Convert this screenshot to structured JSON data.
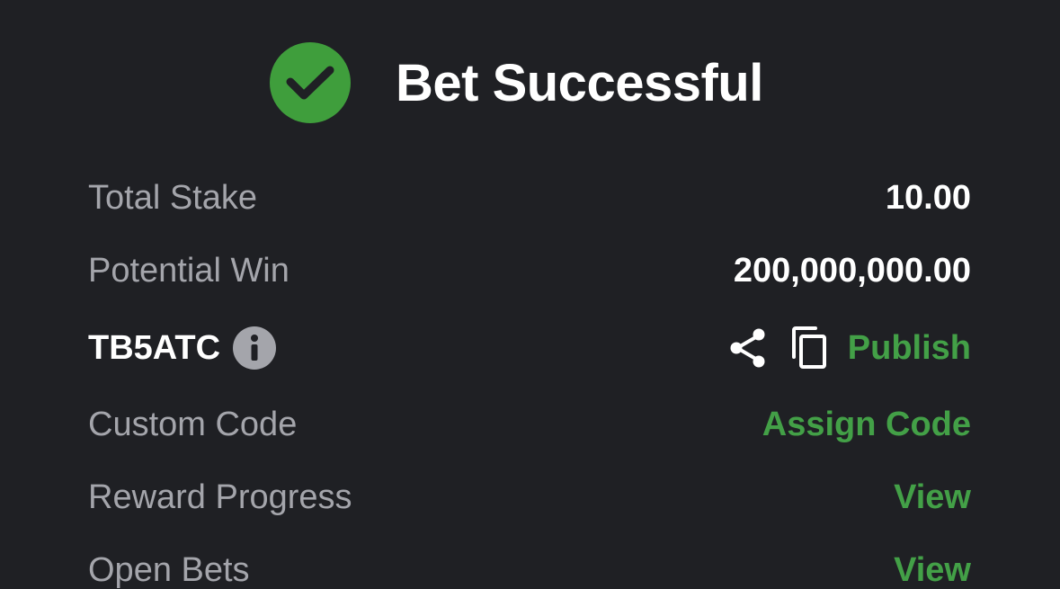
{
  "header": {
    "title": "Bet Successful",
    "check_icon": "check-circle-icon",
    "accent_color": "#3f9e3c"
  },
  "rows": {
    "total_stake": {
      "label": "Total Stake",
      "value": "10.00"
    },
    "potential_win": {
      "label": "Potential Win",
      "value": "200,000,000.00"
    },
    "booking_code": {
      "code": "TB5ATC",
      "info_icon": "info-icon",
      "share_icon": "share-icon",
      "copy_icon": "copy-icon",
      "publish_label": "Publish"
    },
    "custom_code": {
      "label": "Custom Code",
      "action": "Assign Code"
    },
    "reward_progress": {
      "label": "Reward Progress",
      "action": "View"
    },
    "open_bets": {
      "label": "Open Bets",
      "action": "View"
    }
  }
}
